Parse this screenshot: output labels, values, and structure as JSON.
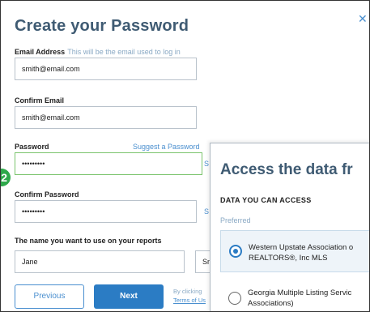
{
  "form": {
    "title": "Create your Password",
    "email_label": "Email Address",
    "email_hint": "This will be the email used to log in",
    "email_value": "smith@email.com",
    "confirm_email_label": "Confirm Email",
    "confirm_email_value": "smith@email.com",
    "password_label": "Password",
    "suggest_link": "Suggest a Password",
    "password_value": "•••••••••",
    "confirm_password_label": "Confirm Password",
    "confirm_password_value": "•••••••••",
    "report_name_label": "The name you want to use on your reports",
    "first_name_value": "Jane",
    "last_name_value": "Sm",
    "cut_link_1": "S",
    "cut_link_2": "S",
    "step_badge": "2",
    "previous_label": "Previous",
    "next_label": "Next",
    "terms_line1": "By clicking",
    "terms_line2": "Terms of Us"
  },
  "overlay": {
    "title": "Access the data fr",
    "subtitle": "DATA YOU CAN ACCESS",
    "preferred_label": "Preferred",
    "options": [
      {
        "line1": "Western Upstate Association o",
        "line2": "REALTORS®, Inc MLS",
        "selected": true
      },
      {
        "line1": "Georgia Multiple Listing Servic",
        "line2": "Associations)",
        "selected": false
      }
    ]
  }
}
